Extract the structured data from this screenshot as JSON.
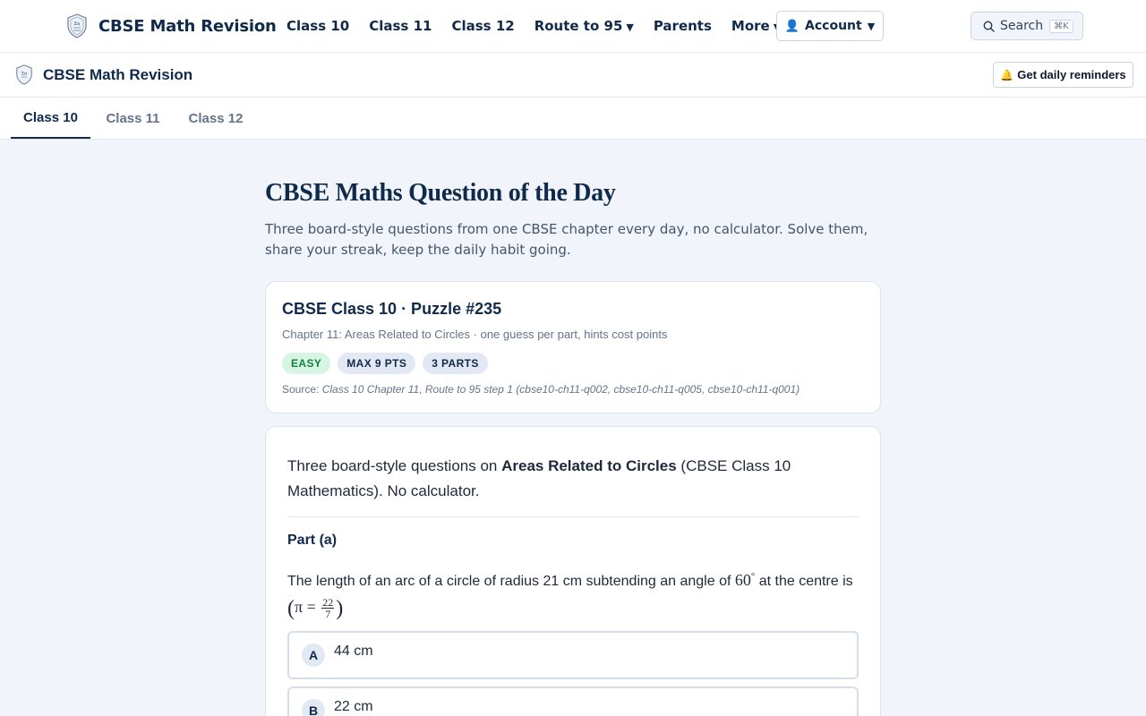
{
  "topnav": {
    "brand": "CBSE Math Revision",
    "links": [
      "Class 10",
      "Class 11",
      "Class 12",
      "Route to 95",
      "Parents",
      "More"
    ],
    "account_label": "Account",
    "search_label": "Search",
    "search_shortcut": "⌘K"
  },
  "subheader": {
    "brand": "CBSE Math Revision",
    "reminder_label": "Get daily reminders"
  },
  "tabs": [
    "Class 10",
    "Class 11",
    "Class 12"
  ],
  "main": {
    "title": "CBSE Maths Question of the Day",
    "description": "Three board-style questions from one CBSE chapter every day, no calculator. Solve them, share your streak, keep the daily habit going."
  },
  "puzzle": {
    "title": "CBSE Class 10 · Puzzle #235",
    "subtitle": "Chapter 11: Areas Related to Circles · one guess per part, hints cost points",
    "badges": [
      "EASY",
      "MAX 9 PTS",
      "3 PARTS"
    ],
    "source_label": "Source:",
    "source_value": "Class 10 Chapter 11, Route to 95 step 1 (cbse10-ch11-q002, cbse10-ch11-q005, cbse10-ch11-q001)"
  },
  "content": {
    "intro_pre": "Three board-style questions on ",
    "intro_topic": "Areas Related to Circles",
    "intro_post": " (CBSE Class 10 Mathematics). No calculator.",
    "part_label": "Part (a)",
    "question_pre": "The length of an arc of a circle of radius 21 cm subtending an angle of ",
    "angle": "60",
    "degree": "°",
    "question_mid": " at the centre is ",
    "pi_expr": "π =",
    "frac_num": "22",
    "frac_den": "7",
    "options": [
      {
        "letter": "A",
        "text": "44 cm"
      },
      {
        "letter": "B",
        "text": "22 cm"
      }
    ]
  },
  "colors": {
    "brand_navy": "#0f2a4a",
    "page_bg": "#f1f5fb",
    "easy_bg": "#d6f5e3",
    "easy_fg": "#15803d"
  }
}
